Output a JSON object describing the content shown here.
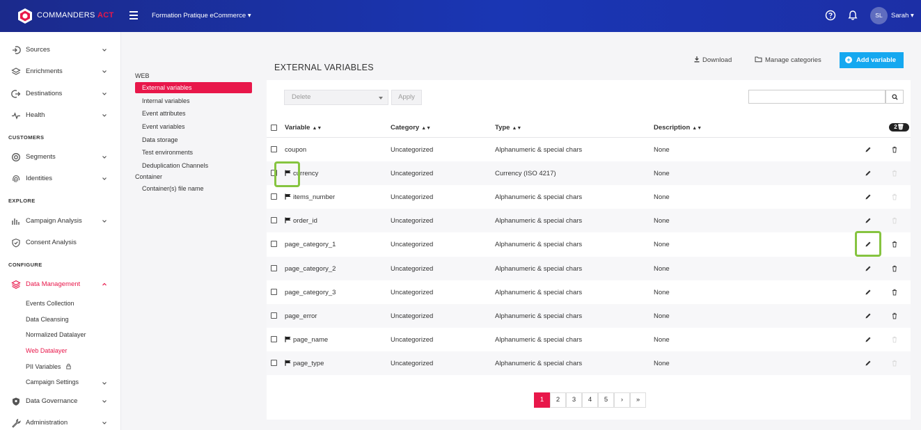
{
  "header": {
    "brand_main": "COMMANDERS",
    "brand_accent": "ACT",
    "site_name": "Formation Pratique eCommerce",
    "user_initials": "SL",
    "user_name": "Sarah"
  },
  "sidebar": {
    "items_top": [
      {
        "label": "Sources",
        "icon": "sources-icon"
      },
      {
        "label": "Enrichments",
        "icon": "enrichments-icon"
      },
      {
        "label": "Destinations",
        "icon": "destinations-icon"
      },
      {
        "label": "Health",
        "icon": "health-icon"
      }
    ],
    "section_customers": "CUSTOMERS",
    "items_customers": [
      {
        "label": "Segments",
        "icon": "segments-icon"
      },
      {
        "label": "Identities",
        "icon": "fingerprint-icon"
      }
    ],
    "section_explore": "EXPLORE",
    "items_explore": [
      {
        "label": "Campaign Analysis",
        "icon": "bar-chart-icon"
      },
      {
        "label": "Consent Analysis",
        "icon": "shield-icon"
      }
    ],
    "section_configure": "CONFIGURE",
    "data_management": "Data Management",
    "sub_items": [
      "Events Collection",
      "Data Cleansing",
      "Normalized Datalayer",
      "Web Datalayer",
      "PII Variables",
      "Campaign Settings"
    ],
    "data_governance": "Data Governance",
    "administration": "Administration"
  },
  "subnav": {
    "group_web": "WEB",
    "web_items": [
      "External variables",
      "Internal variables",
      "Event attributes",
      "Event variables",
      "Data storage",
      "Test environments",
      "Deduplication Channels"
    ],
    "group_container": "Container",
    "container_items": [
      "Container(s) file name"
    ]
  },
  "page": {
    "title": "EXTERNAL VARIABLES",
    "download": "Download",
    "manage_categories": "Manage categories",
    "add_variable": "Add variable",
    "bulk_action": "Delete",
    "apply": "Apply",
    "search_placeholder": ""
  },
  "table": {
    "columns": [
      "Variable",
      "Category",
      "Type",
      "Description"
    ],
    "selected_badge": "2",
    "rows": [
      {
        "variable": "coupon",
        "flag": false,
        "category": "Uncategorized",
        "type": "Alphanumeric & special chars",
        "description": "None",
        "deletable": true
      },
      {
        "variable": "currency",
        "flag": true,
        "category": "Uncategorized",
        "type": "Currency (ISO 4217)",
        "description": "None",
        "deletable": false
      },
      {
        "variable": "items_number",
        "flag": true,
        "category": "Uncategorized",
        "type": "Alphanumeric & special chars",
        "description": "None",
        "deletable": false
      },
      {
        "variable": "order_id",
        "flag": true,
        "category": "Uncategorized",
        "type": "Alphanumeric & special chars",
        "description": "None",
        "deletable": false
      },
      {
        "variable": "page_category_1",
        "flag": false,
        "category": "Uncategorized",
        "type": "Alphanumeric & special chars",
        "description": "None",
        "deletable": true
      },
      {
        "variable": "page_category_2",
        "flag": false,
        "category": "Uncategorized",
        "type": "Alphanumeric & special chars",
        "description": "None",
        "deletable": true
      },
      {
        "variable": "page_category_3",
        "flag": false,
        "category": "Uncategorized",
        "type": "Alphanumeric & special chars",
        "description": "None",
        "deletable": true
      },
      {
        "variable": "page_error",
        "flag": false,
        "category": "Uncategorized",
        "type": "Alphanumeric & special chars",
        "description": "None",
        "deletable": true
      },
      {
        "variable": "page_name",
        "flag": true,
        "category": "Uncategorized",
        "type": "Alphanumeric & special chars",
        "description": "None",
        "deletable": false
      },
      {
        "variable": "page_type",
        "flag": true,
        "category": "Uncategorized",
        "type": "Alphanumeric & special chars",
        "description": "None",
        "deletable": false
      }
    ]
  },
  "pagination": {
    "pages": [
      "1",
      "2",
      "3",
      "4",
      "5"
    ],
    "next": "›",
    "last": "»",
    "current": "1"
  },
  "colors": {
    "accent": "#e8174a",
    "primary_button": "#15a8f0",
    "header_bg": "#1a36b4",
    "highlight": "#86c440"
  }
}
